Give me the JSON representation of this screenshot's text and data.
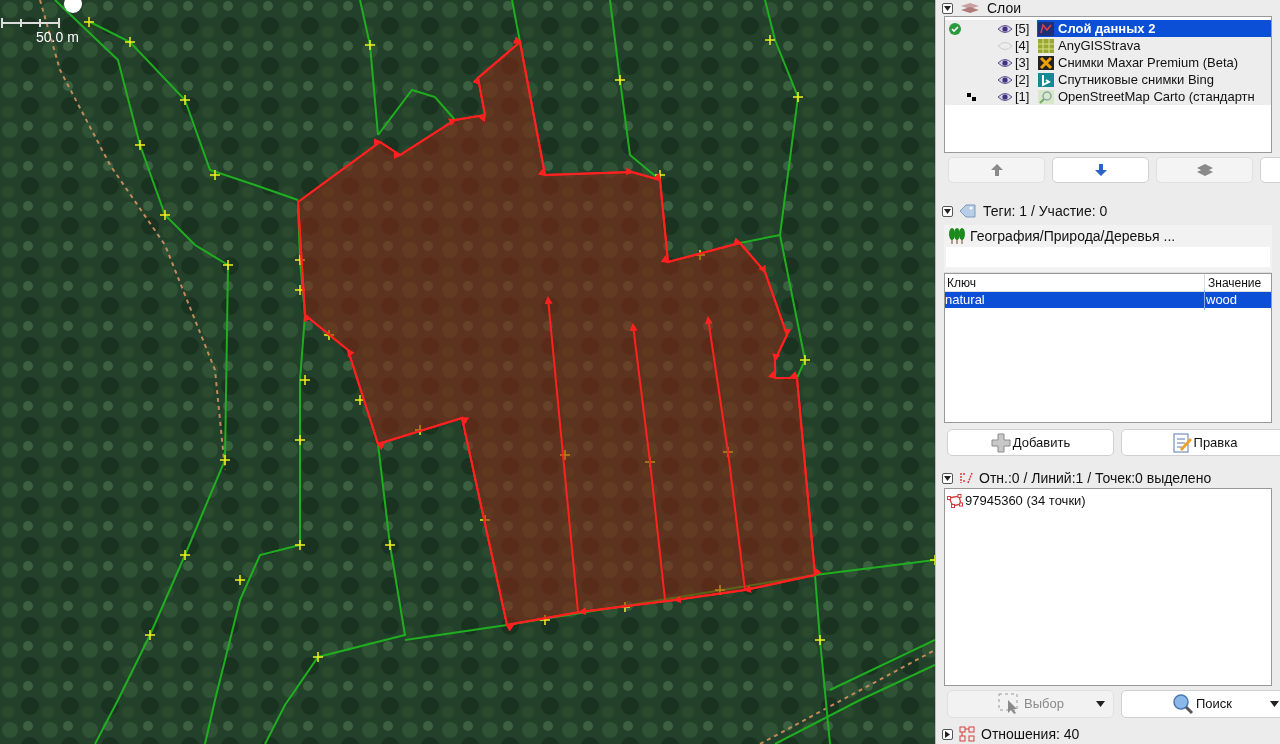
{
  "map": {
    "scale": "50.0 m"
  },
  "layers": {
    "title": "Слои",
    "expanded": true,
    "items": [
      {
        "active": true,
        "background": false,
        "visible": true,
        "index": "[5]",
        "kind": "data",
        "name": "Слой данных 2",
        "selected": true
      },
      {
        "active": false,
        "background": false,
        "visible": false,
        "index": "[4]",
        "kind": "grid",
        "name": "AnyGISStrava",
        "selected": false
      },
      {
        "active": false,
        "background": false,
        "visible": true,
        "index": "[3]",
        "kind": "maxar",
        "name": "Снимки Maxar Premium (Beta)",
        "selected": false
      },
      {
        "active": false,
        "background": false,
        "visible": true,
        "index": "[2]",
        "kind": "bing",
        "name": "Спутниковые снимки Bing",
        "selected": false
      },
      {
        "active": false,
        "background": true,
        "visible": true,
        "index": "[1]",
        "kind": "osm",
        "name": "OpenStreetMap Carto (стандартн",
        "selected": false
      }
    ],
    "buttons": [
      {
        "kind": "up",
        "enabled": false
      },
      {
        "kind": "down",
        "enabled": true
      },
      {
        "kind": "merge",
        "enabled": false
      },
      {
        "kind": "blank",
        "enabled": true
      }
    ]
  },
  "tags": {
    "title": "Теги: 1 / Участие: 0",
    "expanded": true,
    "preset": "География/Природа/Деревья ...",
    "columns": [
      "Ключ",
      "Значение"
    ],
    "rows": [
      {
        "key": "natural",
        "value": "wood",
        "selected": true
      }
    ],
    "buttons": [
      {
        "kind": "add",
        "label": "Добавить"
      },
      {
        "kind": "edit",
        "label": "Правка"
      }
    ]
  },
  "selection": {
    "title": "Отн.:0 / Линий:1 / Точек:0 выделено",
    "expanded": true,
    "items": [
      "97945360 (34 точки)"
    ],
    "buttons": [
      {
        "kind": "select",
        "label": "Выбор",
        "enabled": false
      },
      {
        "kind": "search",
        "label": "Поиск",
        "enabled": true
      }
    ]
  },
  "relations": {
    "title": "Отношения: 40",
    "expanded": false
  }
}
